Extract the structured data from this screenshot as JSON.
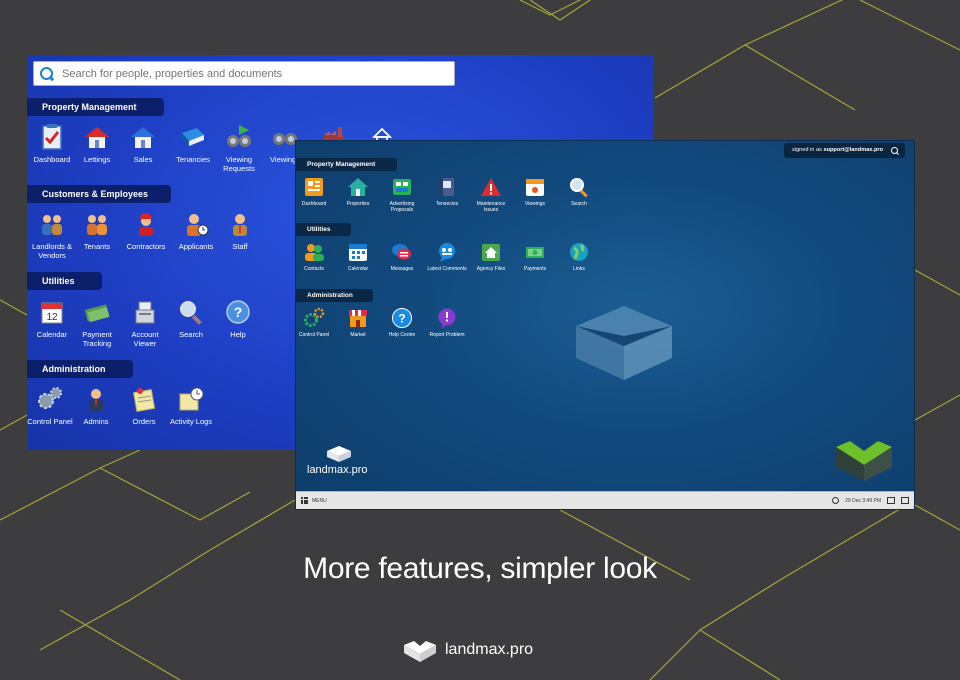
{
  "old_ui": {
    "search": {
      "placeholder": "Search for people, properties and documents"
    },
    "sections": [
      {
        "title": "Property Management",
        "items": [
          {
            "label": "Dashboard",
            "icon": "clipboard-check-icon"
          },
          {
            "label": "Lettings",
            "icon": "house-red-roof-icon"
          },
          {
            "label": "Sales",
            "icon": "house-blue-roof-icon"
          },
          {
            "label": "Tenancies",
            "icon": "book-icon"
          },
          {
            "label": "Viewing Requests",
            "icon": "binoculars-arrow-icon"
          },
          {
            "label": "Viewings",
            "icon": "binoculars-icon"
          },
          {
            "label": "",
            "icon": "factory-icon"
          },
          {
            "label": "",
            "icon": "home-outline-icon"
          }
        ]
      },
      {
        "title": "Customers & Employees",
        "items": [
          {
            "label": "Landlords & Vendors",
            "icon": "people-pair-icon"
          },
          {
            "label": "Tenants",
            "icon": "people-group-icon"
          },
          {
            "label": "Contractors",
            "icon": "worker-icon"
          },
          {
            "label": "Applicants",
            "icon": "person-clock-icon"
          },
          {
            "label": "Staff",
            "icon": "staff-person-icon"
          }
        ]
      },
      {
        "title": "Utilities",
        "items": [
          {
            "label": "Calendar",
            "icon": "calendar-icon"
          },
          {
            "label": "Payment Tracking",
            "icon": "money-icon"
          },
          {
            "label": "Account Viewer",
            "icon": "cash-register-icon"
          },
          {
            "label": "Search",
            "icon": "magnifier-icon"
          },
          {
            "label": "Help",
            "icon": "help-icon"
          }
        ]
      },
      {
        "title": "Administration",
        "items": [
          {
            "label": "Control Panel",
            "icon": "gears-icon"
          },
          {
            "label": "Admins",
            "icon": "admin-person-icon"
          },
          {
            "label": "Orders",
            "icon": "orders-notepad-icon"
          },
          {
            "label": "Activity Logs",
            "icon": "activity-log-icon"
          }
        ]
      }
    ]
  },
  "new_ui": {
    "signed_in_prefix": "signed in as",
    "signed_in_user": "support@landmax.pro",
    "brand": "landmax.pro",
    "taskbar": {
      "menu_label": "MENU",
      "datetime": "29 Dec 3:49 PM"
    },
    "sections": [
      {
        "title": "Property Management",
        "items": [
          {
            "label": "Dashboard",
            "icon": "dashboard-icon"
          },
          {
            "label": "Properties",
            "icon": "house-icon"
          },
          {
            "label": "Advertising Proposals",
            "icon": "advertising-icon"
          },
          {
            "label": "Tenancies",
            "icon": "tenancy-book-icon"
          },
          {
            "label": "Maintenance Issues",
            "icon": "warning-icon"
          },
          {
            "label": "Viewings",
            "icon": "viewings-calendar-icon"
          },
          {
            "label": "Search",
            "icon": "search-icon"
          }
        ]
      },
      {
        "title": "Utilities",
        "items": [
          {
            "label": "Contacts",
            "icon": "contacts-icon"
          },
          {
            "label": "Calendar",
            "icon": "calendar-icon"
          },
          {
            "label": "Messages",
            "icon": "messages-icon"
          },
          {
            "label": "Latest Comments",
            "icon": "comments-icon"
          },
          {
            "label": "Agency Files",
            "icon": "agency-files-icon"
          },
          {
            "label": "Payments",
            "icon": "payments-icon"
          },
          {
            "label": "Links",
            "icon": "globe-icon"
          }
        ]
      },
      {
        "title": "Administration",
        "items": [
          {
            "label": "Control Panel",
            "icon": "gears-icon"
          },
          {
            "label": "Market",
            "icon": "market-icon"
          },
          {
            "label": "Help Centre",
            "icon": "help-icon"
          },
          {
            "label": "Report Problem",
            "icon": "report-icon"
          }
        ]
      }
    ]
  },
  "tagline": "More features, simpler look",
  "footer_brand": "landmax.pro",
  "colors": {
    "old_bg": "#1e3fc4",
    "new_bg": "#124a7e",
    "accent_green": "#6fbf2a",
    "line_yellow": "#c8c43a"
  }
}
